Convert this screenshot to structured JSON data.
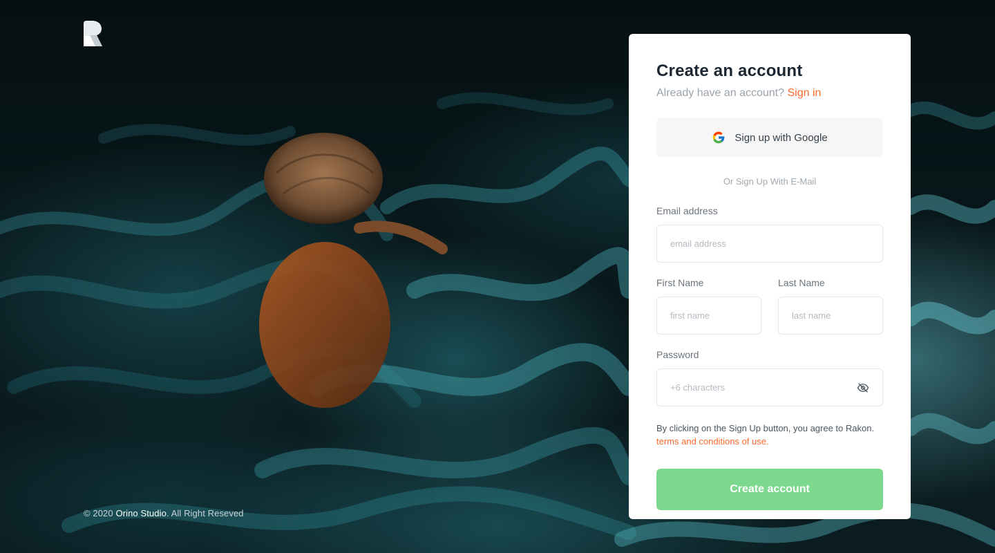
{
  "footer": {
    "prefix": "© 2020 ",
    "brand": "Orino Studio",
    "suffix": ". All Right Reseved"
  },
  "form": {
    "title": "Create an account",
    "subtitle": "Already have an account?",
    "sign_in_link": "Sign in",
    "google_button": "Sign up with Google",
    "divider": "Or Sign Up With E-Mail",
    "email_label": "Email address",
    "email_placeholder": "email address",
    "first_name_label": "First Name",
    "first_name_placeholder": "first name",
    "last_name_label": "Last Name",
    "last_name_placeholder": "last name",
    "password_label": "Password",
    "password_placeholder": "+6 characters",
    "terms_text": "By clicking on the Sign Up button, you agree to Rakon.",
    "terms_link": "terms and conditions of use.",
    "submit_button": "Create account"
  },
  "icons": {
    "logo": "rakon-logo-icon",
    "google": "google-icon",
    "password_toggle": "eye-off-icon"
  },
  "colors": {
    "accent": "#ff6a2b",
    "submit": "#7bd88c",
    "title": "#1b2733"
  }
}
